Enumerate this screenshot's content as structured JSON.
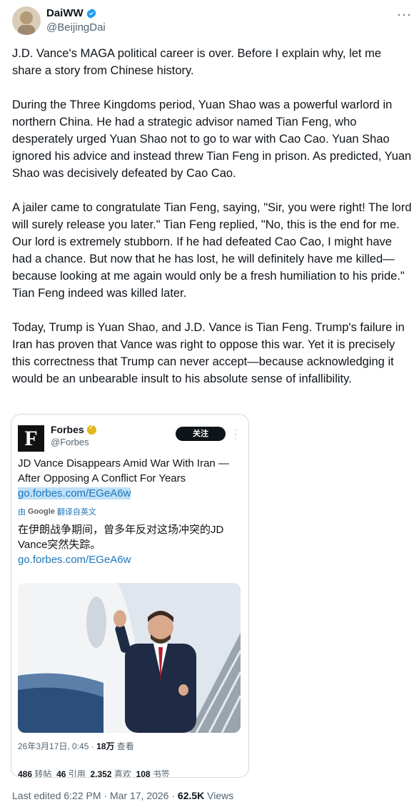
{
  "author": {
    "display_name": "DaiWW",
    "handle": "@BeijingDai",
    "verified_icon": "verified-badge-icon",
    "accent_color": "#1d9bf0"
  },
  "tweet": {
    "text": "J.D. Vance's MAGA political career is over. Before I explain why, let me share a story from Chinese history.\n\nDuring the Three Kingdoms period, Yuan Shao was a powerful warlord in northern China. He had a strategic advisor named Tian Feng, who desperately urged Yuan Shao not to go to war with Cao Cao. Yuan Shao ignored his advice and instead threw Tian Feng in prison. As predicted, Yuan Shao was decisively defeated by Cao Cao.\n\nA jailer came to congratulate Tian Feng, saying, \"Sir, you were right! The lord will surely release you later.\" Tian Feng replied, \"No, this is the end for me. Our lord is extremely stubborn. If he had defeated Cao Cao, I might have had a chance. But now that he has lost, he will definitely have me killed—because looking at me again would only be a fresh humiliation to his pride.\" Tian Feng indeed was killed later.\n\nToday, Trump is Yuan Shao, and J.D. Vance is Tian Feng. Trump's failure in Iran has proven that Vance was right to oppose this war. Yet it is precisely this correctness that Trump can never accept—because acknowledging it would be an unbearable insult to his absolute sense of infallibility.",
    "edited_label": "Last edited 6:22 PM · Mar 17, 2026 ·",
    "views_count": "62.5K",
    "views_label": "Views"
  },
  "quote": {
    "logo_letter": "F",
    "name": "Forbes",
    "handle": "@Forbes",
    "follow_label": "关注",
    "headline": "JD Vance Disappears Amid War With Iran —After Opposing A Conflict For Years",
    "link": "go.forbes.com/EGeA6w",
    "translate_prefix": "由",
    "translate_brand": "Google",
    "translate_suffix": "翻译自英文",
    "translated_text": "在伊朗战争期间，曾多年反对这场冲突的JD Vance突然失踪。",
    "translated_link": "go.forbes.com/EGeA6w",
    "timestamp": "26年3月17日, 0:45 ·",
    "views_count": "18万",
    "views_label": "查看",
    "stats": {
      "retweets": "486",
      "retweets_label": "转帖",
      "quotes": "46",
      "quotes_label": "引用",
      "likes": "2,352",
      "likes_label": "喜欢",
      "bookmarks": "108",
      "bookmarks_label": "书签"
    }
  }
}
